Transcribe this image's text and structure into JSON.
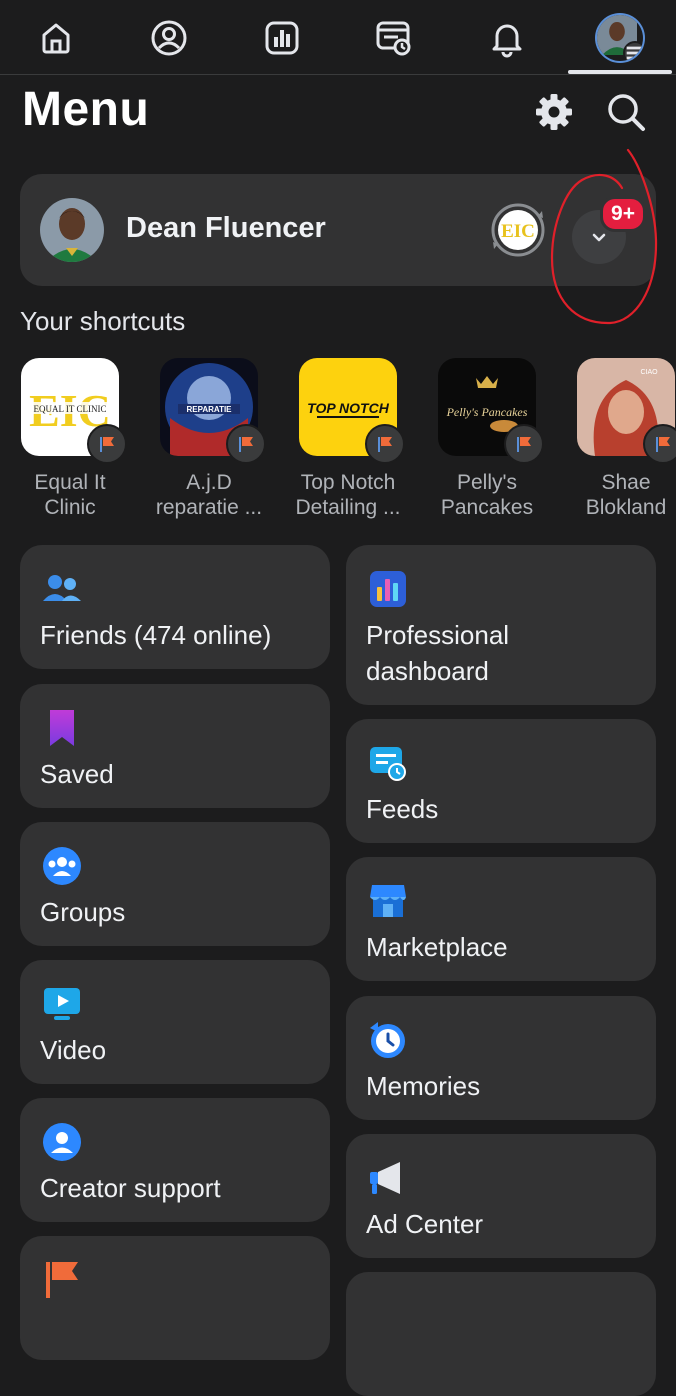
{
  "nav": {
    "items": [
      {
        "name": "home-icon"
      },
      {
        "name": "profile-icon"
      },
      {
        "name": "dashboard-icon"
      },
      {
        "name": "feeds-icon"
      },
      {
        "name": "notifications-icon"
      },
      {
        "name": "menu-avatar"
      }
    ]
  },
  "header": {
    "title": "Menu",
    "icons": [
      "settings-icon",
      "search-icon"
    ]
  },
  "profile": {
    "name": "Dean Fluencer",
    "badge": "9+"
  },
  "shortcuts": {
    "title": "Your shortcuts",
    "items": [
      {
        "label": "Equal It\nClinic",
        "logo_text": "EIC",
        "logo_sub": "EQUAL IT CLINIC"
      },
      {
        "label": "A.j.D\nreparatie ...",
        "logo_text": "REPARATIE"
      },
      {
        "label": "Top Notch\nDetailing ...",
        "logo_text": "TOP NOTCH"
      },
      {
        "label": "Pelly's\nPancakes",
        "logo_text": "Pelly's Pancakes"
      },
      {
        "label": "Shae\nBlokland",
        "logo_text": "CIAO"
      }
    ]
  },
  "tiles": {
    "left": [
      {
        "label": "Friends (474 online)",
        "icon": "friends-icon"
      },
      {
        "label": "Saved",
        "icon": "saved-icon"
      },
      {
        "label": "Groups",
        "icon": "groups-icon"
      },
      {
        "label": "Video",
        "icon": "video-icon"
      },
      {
        "label": "Creator support",
        "icon": "creator-support-icon"
      }
    ],
    "right": [
      {
        "label": "Professional\ndashboard",
        "icon": "professional-dashboard-icon"
      },
      {
        "label": "Feeds",
        "icon": "feeds-icon"
      },
      {
        "label": "Marketplace",
        "icon": "marketplace-icon"
      },
      {
        "label": "Memories",
        "icon": "memories-icon"
      },
      {
        "label": "Ad Center",
        "icon": "ad-center-icon"
      }
    ]
  },
  "colors": {
    "background": "#1c1c1d",
    "card": "#323233",
    "badge": "#e41e3f",
    "annotation": "#e0202a"
  }
}
